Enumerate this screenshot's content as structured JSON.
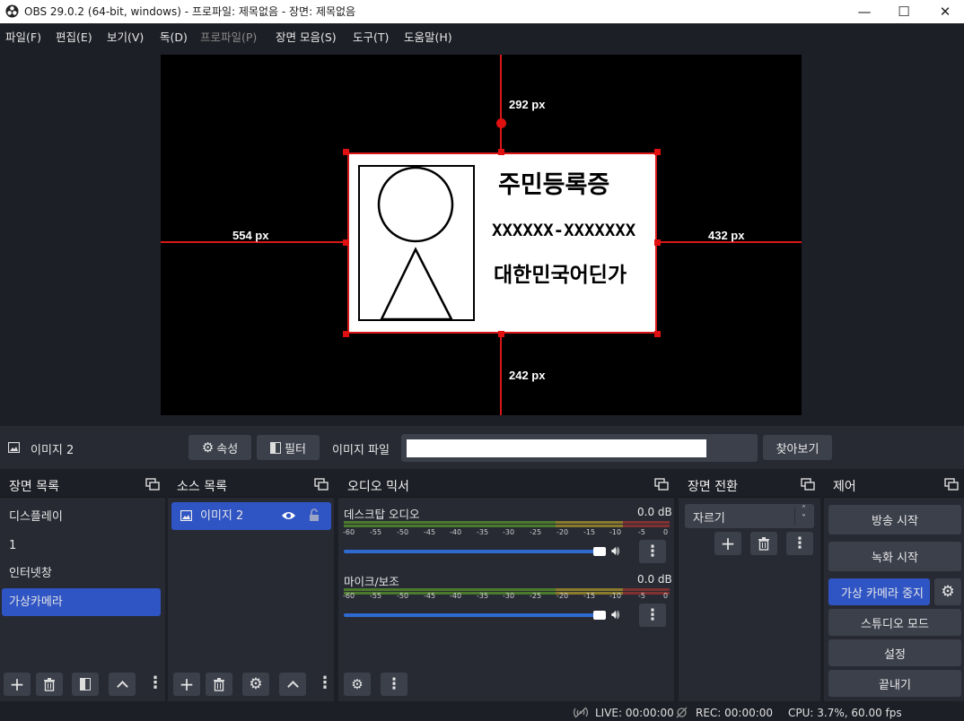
{
  "window": {
    "title": "OBS 29.0.2 (64-bit, windows) - 프로파일: 제목없음 - 장면: 제목없음",
    "minimize_symbol": "—",
    "maximize_symbol": "☐",
    "close_symbol": "✕"
  },
  "menu": [
    "파일(F)",
    "편집(E)",
    "보기(V)",
    "독(D)",
    "프로파일(P)",
    "장면 모음(S)",
    "도구(T)",
    "도움말(H)"
  ],
  "preview": {
    "guides": {
      "top": "292 px",
      "left": "554 px",
      "right": "432 px",
      "bottom": "242 px"
    },
    "card": {
      "title": "주민등록증",
      "number": "XXXXXX-XXXXXXX",
      "name": "대한민국어딘가"
    }
  },
  "source_toolbar": {
    "source_name": "이미지 2",
    "properties_label": "속성",
    "filters_label": "필터",
    "image_file_label": "이미지 파일",
    "browse_label": "찾아보기",
    "image_file_value": ""
  },
  "scenes": {
    "title": "장면 목록",
    "items": [
      "디스플레이",
      "1",
      "인터넷창",
      "가상카메라"
    ],
    "selected": "가상카메라"
  },
  "sources": {
    "title": "소스 목록",
    "items": [
      "이미지 2"
    ]
  },
  "mixer": {
    "title": "오디오 믹서",
    "channels": [
      {
        "name": "데스크탑 오디오",
        "level": "0.0 dB",
        "volume": 1.0
      },
      {
        "name": "마이크/보조",
        "level": "0.0 dB",
        "volume": 1.0
      }
    ],
    "ticks": [
      "-60",
      "-55",
      "-50",
      "-45",
      "-40",
      "-35",
      "-30",
      "-25",
      "-20",
      "-15",
      "-10",
      "-5",
      "0"
    ]
  },
  "transitions": {
    "title": "장면 전환",
    "selected": "자르기"
  },
  "controls": {
    "title": "제어",
    "start_streaming": "방송 시작",
    "start_recording": "녹화 시작",
    "virtual_camera": "가상 카메라 중지",
    "studio_mode": "스튜디오 모드",
    "settings": "설정",
    "exit": "끝내기"
  },
  "status": {
    "live": "LIVE: 00:00:00",
    "rec": "REC: 00:00:00",
    "cpu": "CPU: 3.7%, 60.00 fps"
  },
  "colors": {
    "accent": "#2f54c4",
    "handle": "#e01010",
    "panel": "#272a33",
    "background": "#1d1f26"
  }
}
